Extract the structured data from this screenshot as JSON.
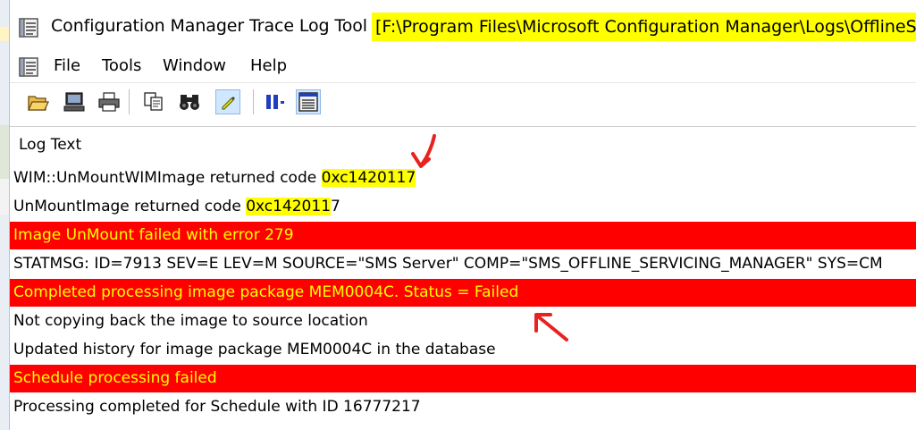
{
  "window": {
    "title_prefix": "Configuration Manager Trace Log Tool - ",
    "title_path": "[F:\\Program Files\\Microsoft Configuration Manager\\Logs\\OfflineSer"
  },
  "menu": {
    "items": [
      {
        "label": "File"
      },
      {
        "label": "Tools"
      },
      {
        "label": "Window"
      },
      {
        "label": "Help"
      }
    ]
  },
  "toolbar": {
    "buttons": [
      {
        "icon": "open-folder-icon"
      },
      {
        "icon": "computer-icon"
      },
      {
        "icon": "printer-icon"
      },
      {
        "icon": "copy-icon"
      },
      {
        "icon": "find-binoculars-icon"
      },
      {
        "icon": "highlight-icon"
      },
      {
        "icon": "pause-icon"
      },
      {
        "icon": "log-view-icon"
      }
    ]
  },
  "log": {
    "header": "Log Text",
    "rows": [
      {
        "pre": "WIM::UnMountWIMImage returned code ",
        "code": "0xc1420117",
        "post": "",
        "error": false
      },
      {
        "pre": "UnMountImage returned code ",
        "code": "0xc142011",
        "post": "7",
        "error": false
      },
      {
        "text": "Image UnMount failed with error 279",
        "error": true
      },
      {
        "text": "STATMSG: ID=7913 SEV=E LEV=M SOURCE=\"SMS Server\" COMP=\"SMS_OFFLINE_SERVICING_MANAGER\" SYS=CM",
        "error": false
      },
      {
        "text": "Completed processing image package MEM0004C. Status = Failed",
        "error": true
      },
      {
        "text": "Not copying back  the image to source location",
        "error": false
      },
      {
        "text": "Updated history for image package MEM0004C in the database",
        "error": false
      },
      {
        "text": "Schedule processing failed",
        "error": true
      },
      {
        "text": "Processing completed for Schedule with ID 16777217",
        "error": false
      }
    ]
  },
  "colors": {
    "error_row_bg": "#ff0000",
    "error_row_text": "#ffff00",
    "highlight": "#ffff00",
    "annotation_arrow": "#e8231f"
  }
}
